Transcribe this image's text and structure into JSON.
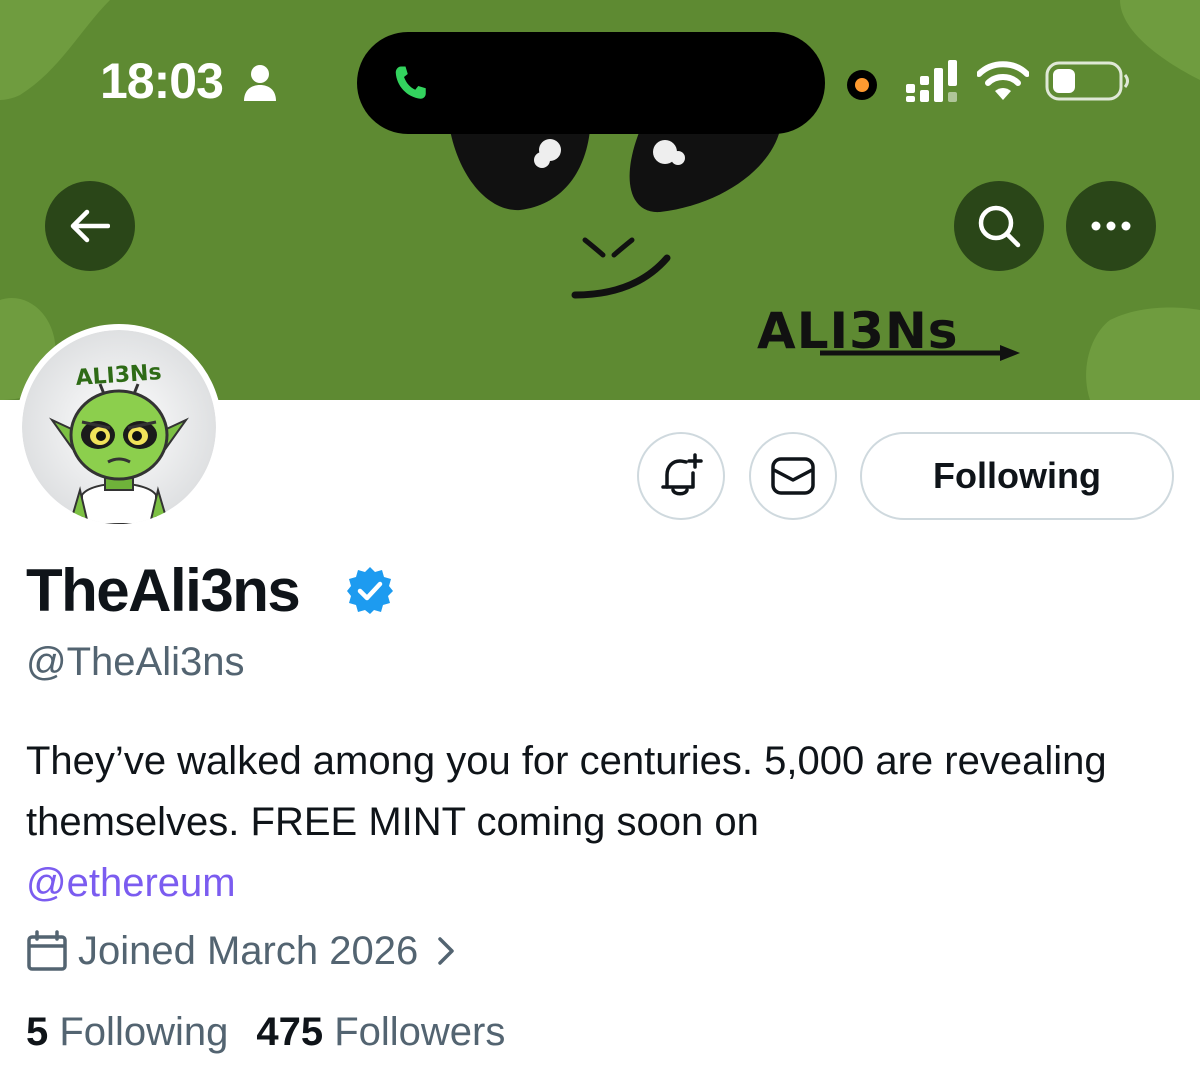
{
  "status_bar": {
    "time": "18:03"
  },
  "banner": {
    "title": "ALI3Ns",
    "avatar_text": "ALI3Ns",
    "background_color": "#5e8a32"
  },
  "header_buttons": {
    "back_icon": "arrow-left-icon",
    "search_icon": "search-icon",
    "more_icon": "more-horizontal-icon"
  },
  "actions": {
    "notify_icon": "bell-plus-icon",
    "message_icon": "envelope-icon",
    "following_label": "Following"
  },
  "profile": {
    "display_name": "TheAli3ns",
    "verified": true,
    "verified_color": "#1d9bf0",
    "handle": "@TheAli3ns",
    "bio_text": "They’ve walked among you for centuries. 5,000 are revealing themselves. FREE MINT coming soon on",
    "bio_mention": "@ethereum",
    "mention_color": "#7b5cf0",
    "joined": "Joined March 2026"
  },
  "stats": {
    "following_count": "5",
    "following_label": "Following",
    "followers_count": "475",
    "followers_label": "Followers"
  }
}
